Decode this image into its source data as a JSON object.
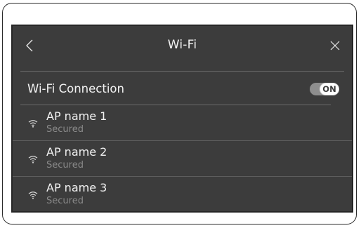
{
  "header": {
    "title": "Wi-Fi",
    "back_icon": "chevron-left-icon",
    "close_icon": "close-icon"
  },
  "connection": {
    "label": "Wi-Fi Connection",
    "toggle_text": "ON",
    "enabled": true
  },
  "access_points": [
    {
      "name": "AP name 1",
      "security": "Secured",
      "icon": "wifi-icon"
    },
    {
      "name": "AP name 2",
      "security": "Secured",
      "icon": "wifi-icon"
    },
    {
      "name": "AP name 3",
      "security": "Secured",
      "icon": "wifi-icon"
    }
  ],
  "colors": {
    "screen_bg": "#3c3c3c",
    "text": "#f2f2f2",
    "subtext": "#8a8a8a",
    "toggle_track": "#8e8e8e"
  }
}
